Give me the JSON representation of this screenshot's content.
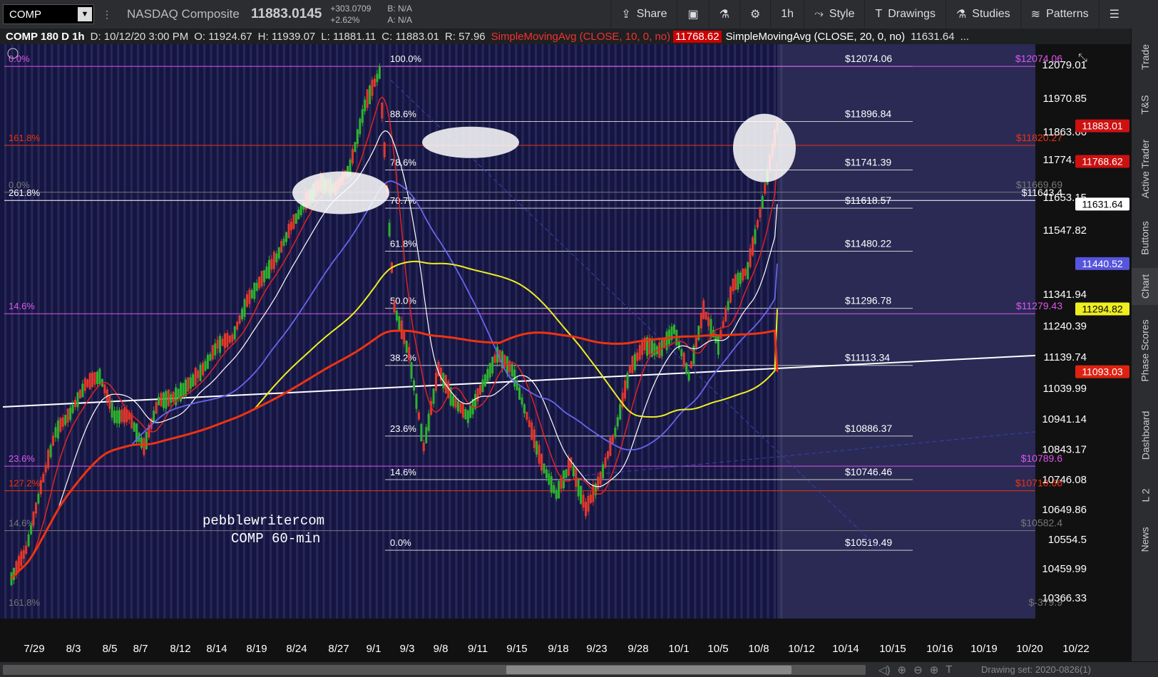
{
  "toolbar": {
    "symbol": "COMP",
    "name": "NASDAQ Composite",
    "last": "11883.0145",
    "change": "+303.0709",
    "change_pct": "+2.62%",
    "bid": "B: N/A",
    "ask": "A: N/A",
    "share": "Share",
    "aggregation": "1h",
    "style": "Style",
    "drawings": "Drawings",
    "studies": "Studies",
    "patterns": "Patterns"
  },
  "infobar": {
    "header": "COMP 180 D 1h",
    "date": "D: 10/12/20 3:00 PM",
    "open": "O: 11924.67",
    "high": "H: 11939.07",
    "low": "L: 11881.11",
    "close": "C: 11883.01",
    "range": "R: 57.96",
    "sma10_label": "SimpleMovingAvg (CLOSE, 10, 0, no)",
    "sma10_value": "11768.62",
    "sma20_label": "SimpleMovingAvg (CLOSE, 20, 0, no)",
    "sma20_value": "11631.64",
    "more": "..."
  },
  "sidebar": {
    "tabs": [
      "Trade",
      "T&S",
      "Active Trader",
      "Buttons",
      "Chart",
      "Phase Scores",
      "Dashboard",
      "L 2",
      "News"
    ],
    "active": "Chart"
  },
  "bottom": {
    "drawing_set": "Drawing set: 2020-0826(1)"
  },
  "colors": {
    "background": "#151541",
    "candle_up": "#2db32d",
    "candle_down": "#e3382b",
    "sma10": "#e02222",
    "sma20": "#ffffff",
    "sma50": "#6666ee",
    "sma100": "#eeee22",
    "sma200": "#ee3311",
    "magenta": "#dd55ee"
  },
  "chart_data": {
    "type": "line",
    "title": "COMP 180 D 1h",
    "watermark": [
      "pebblewritercom",
      "COMP 60-min"
    ],
    "x_tick_labels": [
      "7/29",
      "8/3",
      "8/5",
      "8/7",
      "8/12",
      "8/14",
      "8/19",
      "8/24",
      "8/27",
      "9/1",
      "9/3",
      "9/8",
      "9/11",
      "9/15",
      "9/18",
      "9/23",
      "9/28",
      "10/1",
      "10/5",
      "10/8",
      "10/12",
      "10/14",
      "10/15",
      "10/16",
      "10/19",
      "10/20",
      "10/22"
    ],
    "y_tick_labels": [
      "12079.01",
      "11970.85",
      "11863.66",
      "11774.45",
      "11653.15",
      "11547.82",
      "11341.94",
      "11240.39",
      "11139.74",
      "11039.99",
      "10941.14",
      "10843.17",
      "10746.08",
      "10649.86",
      "10554.5",
      "10459.99",
      "10366.33"
    ],
    "ylim": [
      10310,
      12125
    ],
    "close_path": {
      "x": [
        "7/29",
        "7/30",
        "7/31",
        "8/3",
        "8/4",
        "8/5",
        "8/6",
        "8/7",
        "8/10",
        "8/11",
        "8/12",
        "8/13",
        "8/14",
        "8/17",
        "8/18",
        "8/19",
        "8/20",
        "8/21",
        "8/24",
        "8/25",
        "8/26",
        "8/27",
        "8/28",
        "8/31",
        "9/1",
        "9/2",
        "9/3",
        "9/4",
        "9/8",
        "9/9",
        "9/10",
        "9/11",
        "9/14",
        "9/15",
        "9/16",
        "9/17",
        "9/18",
        "9/21",
        "9/22",
        "9/23",
        "9/24",
        "9/25",
        "9/28",
        "9/29",
        "9/30",
        "10/1",
        "10/2",
        "10/5",
        "10/6",
        "10/7",
        "10/8",
        "10/9",
        "10/12"
      ],
      "values": [
        10430,
        10520,
        10720,
        10900,
        10960,
        11050,
        11080,
        10950,
        10950,
        10850,
        11000,
        11010,
        11050,
        11100,
        11180,
        11200,
        11320,
        11390,
        11460,
        11560,
        11640,
        11700,
        11680,
        11750,
        11950,
        12056,
        11300,
        11150,
        10850,
        11100,
        11000,
        10950,
        11050,
        11150,
        11100,
        10950,
        10800,
        10700,
        10800,
        10650,
        10750,
        10900,
        11100,
        11180,
        11160,
        11230,
        11080,
        11290,
        11180,
        11370,
        11420,
        11640,
        11883
      ]
    },
    "series": [
      {
        "name": "SimpleMovingAvg (CLOSE, 10, 0, no)",
        "color": "#e02222",
        "last": 11768.62
      },
      {
        "name": "SimpleMovingAvg (CLOSE, 20, 0, no)",
        "color": "#ffffff",
        "last": 11631.64
      },
      {
        "name": "",
        "color": "#6666ee",
        "last": 11440.52
      },
      {
        "name": "",
        "color": "#eeee22",
        "last": 11294.82
      },
      {
        "name": "",
        "color": "#ee3311",
        "last": 11093.03
      }
    ],
    "fib_main": [
      {
        "pct": "100.0%",
        "value": 12074.06,
        "label": "$12074.06"
      },
      {
        "pct": "88.6%",
        "value": 11896.84,
        "label": "$11896.84"
      },
      {
        "pct": "78.6%",
        "value": 11741.39,
        "label": "$11741.39"
      },
      {
        "pct": "70.7%",
        "value": 11618.57,
        "label": "$11618.57"
      },
      {
        "pct": "61.8%",
        "value": 11480.22,
        "label": "$11480.22"
      },
      {
        "pct": "50.0%",
        "value": 11296.78,
        "label": "$11296.78"
      },
      {
        "pct": "38.2%",
        "value": 11113.34,
        "label": "$11113.34"
      },
      {
        "pct": "23.6%",
        "value": 10886.37,
        "label": "$10886.37"
      },
      {
        "pct": "14.6%",
        "value": 10746.46,
        "label": "$10746.46"
      },
      {
        "pct": "0.0%",
        "value": 10519.49,
        "label": "$10519.49"
      }
    ],
    "fib_left": [
      {
        "pct": "0.0%",
        "value": 12074.06,
        "label": "$12074.06",
        "color": "#dd55ee"
      },
      {
        "pct": "161.8%",
        "value": 11820.27,
        "label": "$11820.27",
        "color": "#ee3311"
      },
      {
        "pct": "0.0%",
        "value": 11669.69,
        "label": "$11669.69",
        "color": "#777777"
      },
      {
        "pct": "261.8%",
        "value": 11643.4,
        "label": "$11643.4",
        "color": "#ffffff"
      },
      {
        "pct": "14.6%",
        "value": 11279.43,
        "label": "$11279.43",
        "color": "#dd55ee"
      },
      {
        "pct": "23.6%",
        "value": 10789.6,
        "label": "$10789.6",
        "color": "#dd55ee"
      },
      {
        "pct": "127.2%",
        "value": 10710.66,
        "label": "$10710.66",
        "color": "#ee3311"
      },
      {
        "pct": "14.6%",
        "value": 10582.4,
        "label": "$10582.4",
        "color": "#777777"
      },
      {
        "pct": "161.8%",
        "value": -379.9,
        "label": "$-379.9",
        "color": "#777777"
      }
    ],
    "price_bubbles": [
      {
        "value": 11883.01,
        "label": "11883.01",
        "color": "#cc1111",
        "text": "#fff"
      },
      {
        "value": 11768.62,
        "label": "11768.62",
        "color": "#cc1111",
        "text": "#fff"
      },
      {
        "value": 11631.64,
        "label": "11631.64",
        "color": "#ffffff",
        "text": "#000"
      },
      {
        "value": 11440.52,
        "label": "11440.52",
        "color": "#5555dd",
        "text": "#fff"
      },
      {
        "value": 11294.82,
        "label": "11294.82",
        "color": "#eeee22",
        "text": "#000"
      },
      {
        "value": 11093.03,
        "label": "11093.03",
        "color": "#dd2211",
        "text": "#fff"
      }
    ]
  }
}
